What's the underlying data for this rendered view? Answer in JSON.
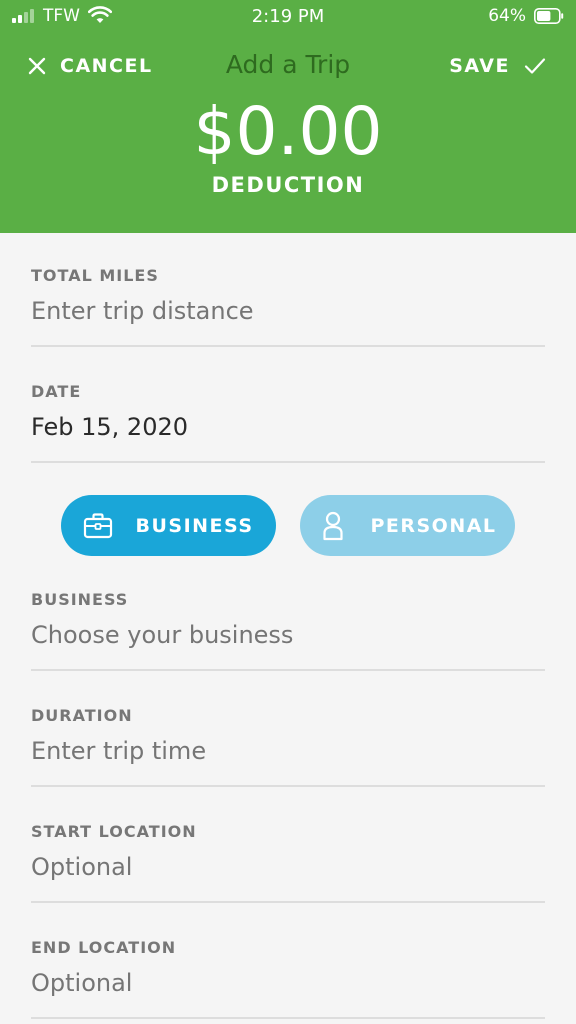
{
  "status_bar": {
    "carrier": "TFW",
    "time": "2:19 PM",
    "battery_percent": "64%",
    "battery_level": 0.64
  },
  "nav": {
    "cancel_label": "CANCEL",
    "title": "Add a Trip",
    "save_label": "SAVE"
  },
  "deduction": {
    "amount": "$0.00",
    "label": "DEDUCTION"
  },
  "form": {
    "total_miles": {
      "label": "TOTAL MILES",
      "placeholder": "Enter trip distance",
      "value": ""
    },
    "date": {
      "label": "DATE",
      "value": "Feb 15, 2020"
    },
    "trip_type": {
      "business_label": "BUSINESS",
      "personal_label": "PERSONAL",
      "selected": "business"
    },
    "business": {
      "label": "BUSINESS",
      "placeholder": "Choose your business"
    },
    "duration": {
      "label": "DURATION",
      "placeholder": "Enter trip time"
    },
    "start_location": {
      "label": "START LOCATION",
      "placeholder": "Optional"
    },
    "end_location": {
      "label": "END LOCATION",
      "placeholder": "Optional"
    }
  },
  "colors": {
    "header_green": "#5aaf45",
    "title_green": "#2e6b1f",
    "business_blue": "#1aa6d8",
    "personal_blue_light": "#8dcfe8",
    "background": "#f5f5f5"
  },
  "icons": {
    "cancel": "close-icon",
    "save": "check-icon",
    "business": "briefcase-icon",
    "personal": "person-icon"
  }
}
